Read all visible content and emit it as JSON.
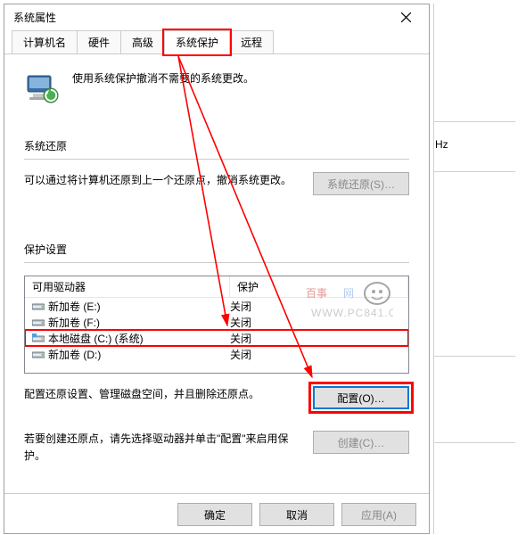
{
  "window": {
    "title": "系统属性"
  },
  "tabs": {
    "t0": "计算机名",
    "t1": "硬件",
    "t2": "高级",
    "t3": "系统保护",
    "t4": "远程"
  },
  "intro_text": "使用系统保护撤消不需要的系统更改。",
  "restore": {
    "heading": "系统还原",
    "text": "可以通过将计算机还原到上一个还原点，撤消系统更改。",
    "button": "系统还原(S)…"
  },
  "protection": {
    "heading": "保护设置",
    "col_drive": "可用驱动器",
    "col_status": "保护",
    "rows": [
      {
        "name": "新加卷 (E:)",
        "status": "关闭",
        "icon": "hdd"
      },
      {
        "name": "新加卷 (F:)",
        "status": "关闭",
        "icon": "hdd"
      },
      {
        "name": "本地磁盘 (C:) (系统)",
        "status": "关闭",
        "icon": "sys"
      },
      {
        "name": "新加卷 (D:)",
        "status": "关闭",
        "icon": "hdd"
      }
    ],
    "config_text": "配置还原设置、管理磁盘空间，并且删除还原点。",
    "config_button": "配置(O)…",
    "create_text": "若要创建还原点，请先选择驱动器并单击\"配置\"来启用保护。",
    "create_button": "创建(C)…"
  },
  "footer": {
    "ok": "确定",
    "cancel": "取消",
    "apply": "应用(A)"
  },
  "side": {
    "hz": "Hz"
  }
}
